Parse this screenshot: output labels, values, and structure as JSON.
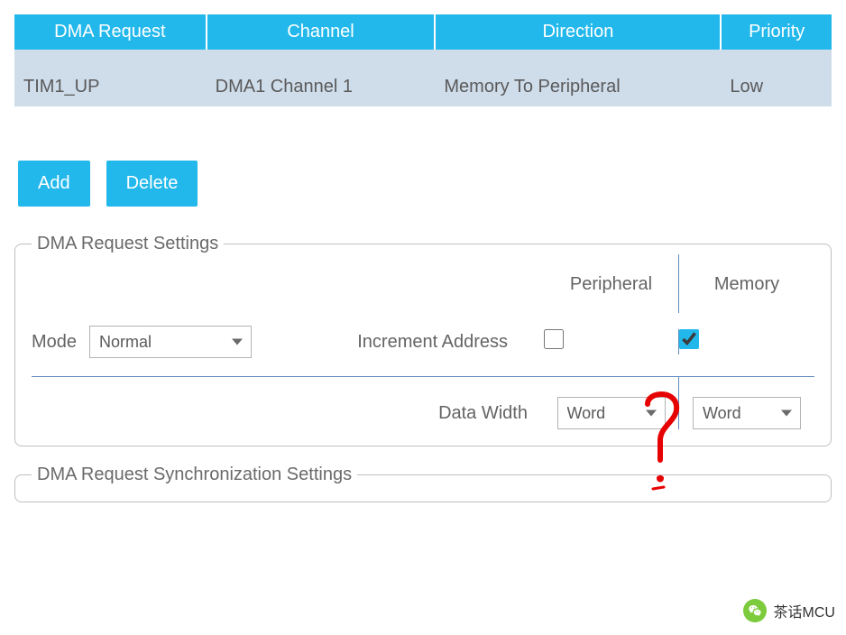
{
  "table": {
    "headers": [
      "DMA Request",
      "Channel",
      "Direction",
      "Priority"
    ],
    "rows": [
      {
        "request": "TIM1_UP",
        "channel": "DMA1 Channel 1",
        "direction": "Memory To Peripheral",
        "priority": "Low"
      }
    ]
  },
  "buttons": {
    "add": "Add",
    "delete": "Delete"
  },
  "settings": {
    "legend": "DMA Request Settings",
    "mode_label": "Mode",
    "mode_value": "Normal",
    "col_peripheral": "Peripheral",
    "col_memory": "Memory",
    "increment_label": "Increment Address",
    "increment_peripheral_checked": false,
    "increment_memory_checked": true,
    "data_width_label": "Data Width",
    "data_width_peripheral": "Word",
    "data_width_memory": "Word"
  },
  "sync": {
    "legend": "DMA Request Synchronization Settings"
  },
  "watermark": {
    "text": "茶话MCU"
  }
}
